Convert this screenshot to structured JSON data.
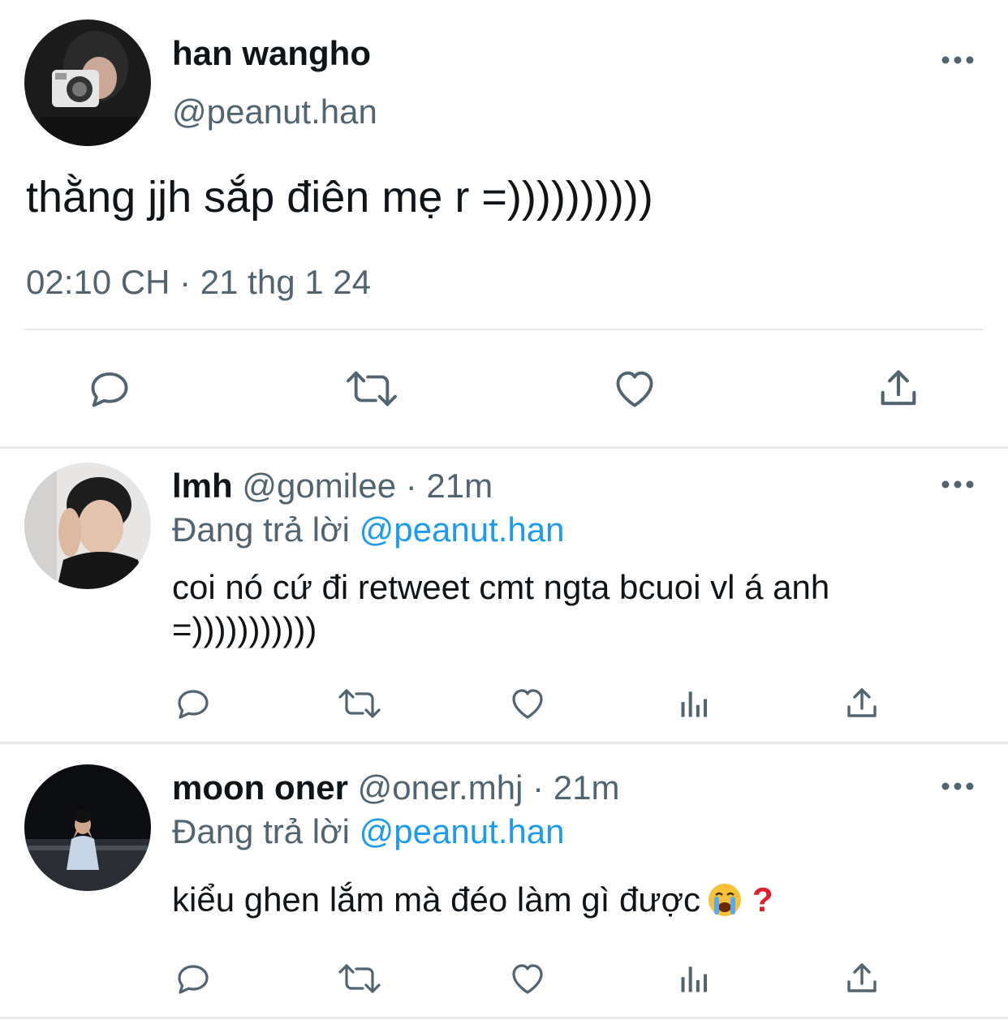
{
  "main_tweet": {
    "display_name": "han wangho",
    "handle": "@peanut.han",
    "text": "thằng jjh sắp điên mẹ r =))))))))))",
    "time": "02:10 CH",
    "separator": "·",
    "date": "21 thg 1 24",
    "avatar_icon": "avatar-photo-camera",
    "actions": [
      "reply-icon",
      "retweet-icon",
      "like-icon",
      "share-icon"
    ]
  },
  "replies": [
    {
      "display_name": "lmh",
      "handle": "@gomilee",
      "separator": "·",
      "time_ago": "21m",
      "replying_to_label": "Đang trả lời",
      "replying_to_handle": "@peanut.han",
      "text": "coi nó cứ đi retweet cmt ngta bcuoi vl á anh =)))))))))))",
      "actions": [
        "reply-icon",
        "retweet-icon",
        "like-icon",
        "analytics-icon",
        "share-icon"
      ]
    },
    {
      "display_name": "moon oner",
      "handle": "@oner.mhj",
      "separator": "·",
      "time_ago": "21m",
      "replying_to_label": "Đang trả lời",
      "replying_to_handle": "@peanut.han",
      "text": "kiểu ghen lắm mà đéo làm gì được",
      "text_emoji_icons": [
        "crying-face-emoji",
        "red-question-mark-emoji"
      ],
      "actions": [
        "reply-icon",
        "retweet-icon",
        "like-icon",
        "analytics-icon",
        "share-icon"
      ]
    }
  ],
  "colors": {
    "text": "#0f1419",
    "secondary": "#536471",
    "link": "#1d9bf0",
    "divider": "#e6e9ec"
  }
}
